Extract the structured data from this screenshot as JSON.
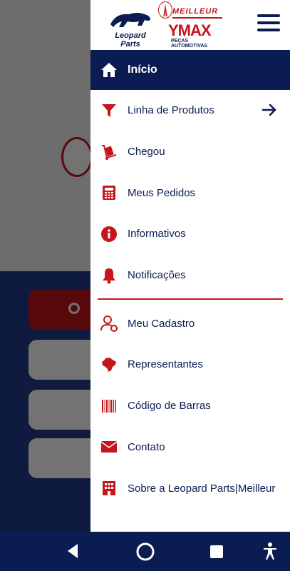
{
  "header": {
    "logo_left_text": "Leopard Parts",
    "logo_right_brand": "MEILLEUR",
    "logo_right_name": "YMAX",
    "logo_right_sub": "PEÇAS AUTOMOTIVAS"
  },
  "menu": {
    "items": [
      {
        "label": "Início",
        "icon": "home-icon",
        "active": true
      },
      {
        "label": "Linha de Produtos",
        "icon": "filter-icon",
        "has_arrow": true
      },
      {
        "label": "Chegou",
        "icon": "hand-truck-icon"
      },
      {
        "label": "Meus Pedidos",
        "icon": "calculator-icon"
      },
      {
        "label": "Informativos",
        "icon": "info-icon"
      },
      {
        "label": "Notificações",
        "icon": "bell-icon"
      },
      {
        "label": "Meu Cadastro",
        "icon": "user-edit-icon"
      },
      {
        "label": "Representantes",
        "icon": "brazil-map-icon"
      },
      {
        "label": "Código de Barras",
        "icon": "barcode-icon"
      },
      {
        "label": "Contato",
        "icon": "envelope-icon"
      },
      {
        "label": "Sobre a Leopard Parts|Meilleur",
        "icon": "building-icon"
      }
    ]
  },
  "colors": {
    "navy": "#0b1c52",
    "red": "#c4161c"
  },
  "navbar": {
    "buttons": [
      "back-icon",
      "home-circle-icon",
      "recents-icon",
      "accessibility-icon"
    ]
  }
}
